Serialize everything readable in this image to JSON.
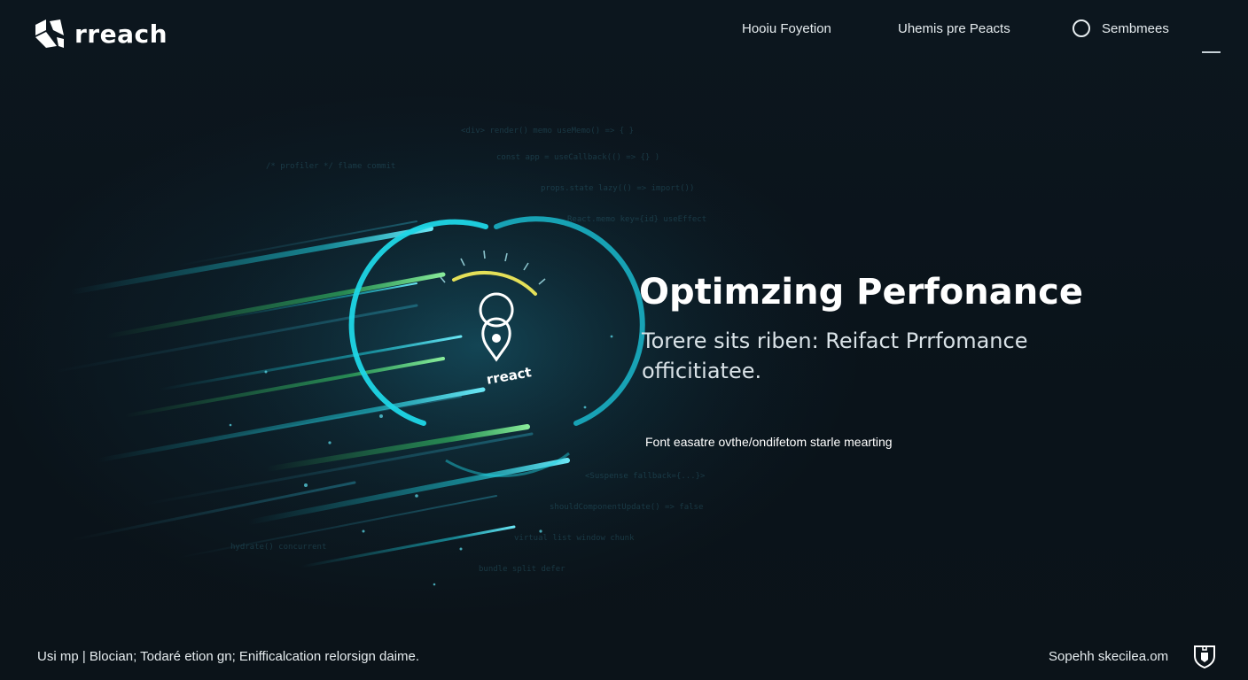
{
  "brand": {
    "name": "rreach",
    "logo_icon": "brand-logo-icon"
  },
  "nav": {
    "links": [
      {
        "label": "Hooiu Foyetion"
      },
      {
        "label": "Uhemis pre Peacts"
      }
    ],
    "account": {
      "label": "Sembmees",
      "icon": "circle-icon"
    },
    "menu_icon": "menu-icon"
  },
  "hero": {
    "title": "Optimzing Perfonance",
    "subtitle": "Torere sits riben: Reifact Prrfomance officitiatee.",
    "note": "Font easatre ovthe/ondifetom starle mearting",
    "gauge_label": "rreact",
    "gauge_icon": "react-pin-icon"
  },
  "footer": {
    "left": "Usi mp | Blocian; Todaré etion gn; Enifficalcation relorsign daime.",
    "right": "Sopehh skecilea.om",
    "badge_icon": "shield-icon"
  },
  "colors": {
    "background": "#0b141c",
    "accent_cyan": "#1fd6e6",
    "accent_green": "#3cd66a",
    "accent_yellow": "#e4e058",
    "text": "#e8eef2"
  }
}
